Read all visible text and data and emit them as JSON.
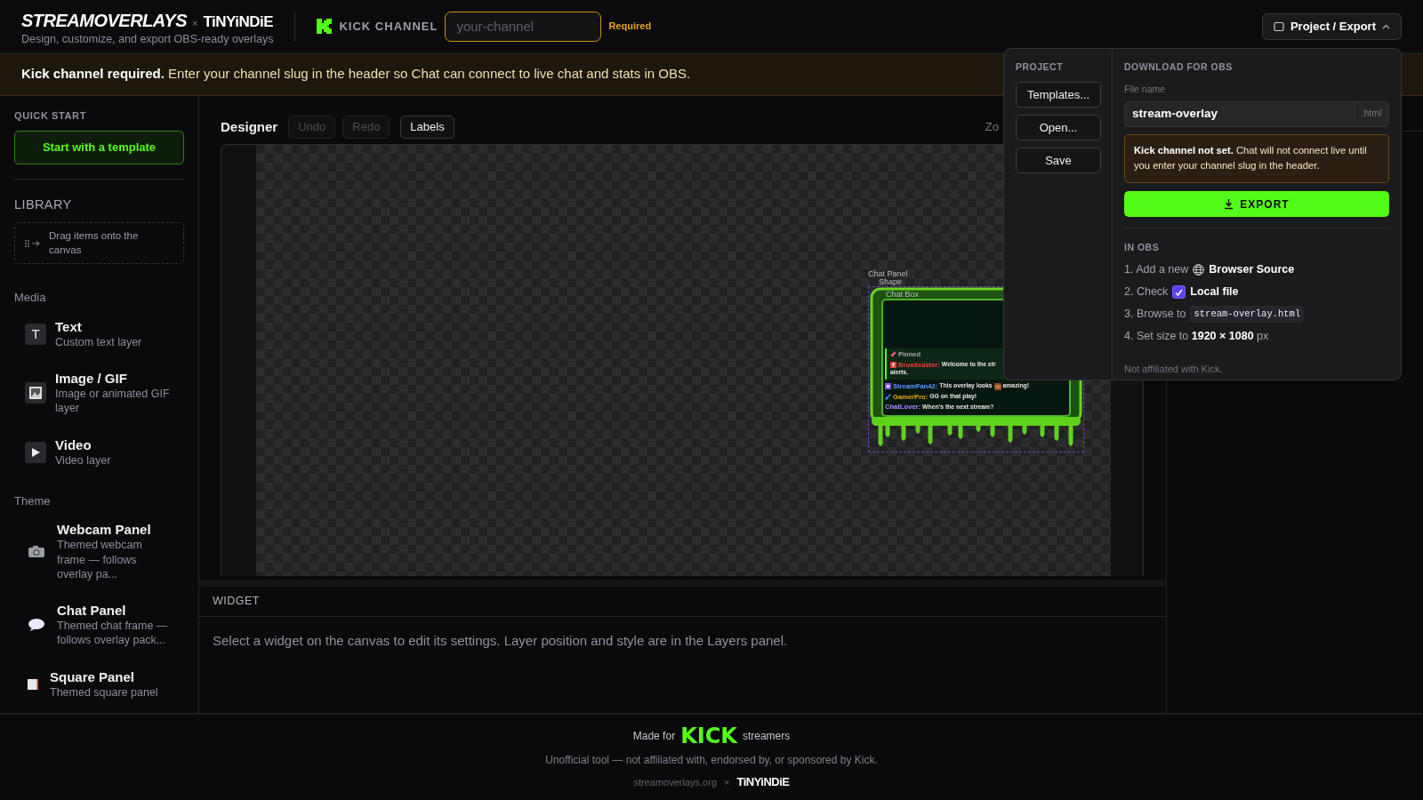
{
  "header": {
    "brand": "STREAMOVERLAYS",
    "separator": "×",
    "partner": "TiNYiNDiE",
    "tagline": "Design, customize, and export OBS-ready overlays",
    "channel_label": "KICK CHANNEL",
    "channel_field": {
      "placeholder": "your-channel"
    },
    "required": "Required",
    "menu_button": {
      "label": "Project / Export",
      "expanded": true
    }
  },
  "banner": {
    "text": "**Kick channel required.** Enter your channel slug in the header so Chat can connect to live chat and stats in OBS."
  },
  "sidebar": {
    "quick_start_title": "QUICK START",
    "template_button": "Start with a template",
    "library_title": "LIBRARY",
    "drag_hint": "Drag items onto the canvas",
    "sections": [
      {
        "title": "Media",
        "items": [
          {
            "kind": "text",
            "icon_text": "T",
            "name": "Text",
            "description": "Custom text layer"
          },
          {
            "kind": "image",
            "name": "Image / GIF",
            "description": "Image or animated GIF layer"
          },
          {
            "kind": "video",
            "name": "Video",
            "description": "Video layer"
          }
        ]
      },
      {
        "title": "Theme",
        "items": [
          {
            "kind": "webcam",
            "name": "Webcam Panel",
            "description": "Themed webcam frame — follows overlay pa..."
          },
          {
            "kind": "chat",
            "name": "Chat Panel",
            "description": "Themed chat frame — follows overlay pack..."
          },
          {
            "kind": "square",
            "name": "Square Panel",
            "description": "Themed square panel"
          }
        ]
      }
    ]
  },
  "designer": {
    "title": "Designer",
    "tools": [
      {
        "label": "Undo",
        "disabled": true
      },
      {
        "label": "Redo",
        "disabled": true
      },
      {
        "label": "Labels",
        "disabled": false
      }
    ],
    "zoom_label": "Zo",
    "canvas": {
      "layer_labels": [
        "Chat Panel",
        "Shape",
        "Chat Box"
      ],
      "pinned_label": "Pinned",
      "messages": [
        {
          "kind": "broadcaster",
          "pinned": true,
          "user": "Broadcaster:",
          "color": "#e8433b",
          "text": "Welcome to the str",
          "continuation": "alerts."
        },
        {
          "kind": "subscriber",
          "pinned": false,
          "user": "StreamFan42:",
          "color": "#5b9cff",
          "text": "This overlay looks",
          "emote": true,
          "text_after": "amazing!"
        },
        {
          "kind": "moderator",
          "pinned": false,
          "user": "GamerPro:",
          "color": "#e9a21b",
          "text": "GG on that play!"
        },
        {
          "kind": "viewer",
          "pinned": false,
          "user": "ChatLover:",
          "color": "#a88bff",
          "text": "When’s the next stream?"
        }
      ]
    }
  },
  "widget_panel": {
    "title": "WIDGET",
    "message": "Select a widget on the canvas to edit its settings. Layer position and style are in the Layers panel."
  },
  "popover": {
    "project_title": "PROJECT",
    "project_buttons": [
      "Templates...",
      "Open...",
      "Save"
    ],
    "download_title": "DOWNLOAD FOR OBS",
    "file_label": "File name",
    "file_name": "stream-overlay",
    "file_ext": ".html",
    "warning": "**Kick channel not set.** Chat will not connect live until you enter your channel slug in the header.",
    "export_button": "EXPORT",
    "obs_title": "IN OBS",
    "steps": [
      {
        "kind": "icon",
        "text": "1. Add a new",
        "label": "Browser Source"
      },
      {
        "kind": "checkbox",
        "text": "2. Check",
        "checked": true,
        "label": "Local file"
      },
      {
        "kind": "code",
        "text": "3. Browse to",
        "code": "stream-overlay.html"
      },
      {
        "kind": "plain",
        "text": "4. Set size to **1920 × 1080** px"
      }
    ],
    "note": "Not affiliated with Kick."
  },
  "footer": {
    "made_for": "Made for",
    "kick_logo": "KICK",
    "streamers": "streamers",
    "disclaimer": "Unofficial tool — not affiliated with, endorsed by, or sponsored by Kick.",
    "site": "streamoverlays.org",
    "separator": "×",
    "partner": "TiNYiNDiE"
  }
}
